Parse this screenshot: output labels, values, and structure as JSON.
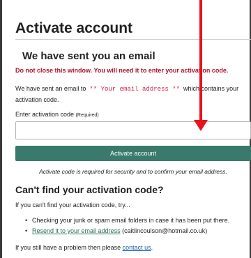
{
  "page": {
    "title": "Activate account",
    "subheading": "We have sent you an email",
    "warning": "Do not close this window. You will need it to enter your activation code.",
    "sent_prefix": "We have sent an email to",
    "email_placeholder": "** Your email address **",
    "sent_suffix": "which contains your activation code.",
    "field_label": "Enter activation code",
    "field_required": "(Required)",
    "field_value": "",
    "button_label": "Activate account",
    "note": "Activate code is required for security and to confirm your email address.",
    "help_heading": "Can't find your activation code?",
    "help_intro": "If you can't find your activation code, try...",
    "tips": {
      "tip1": "Checking your junk or spam email folders in case it has been put there.",
      "resend_link": "Resend it to your email address",
      "resend_email": "(caitlincoulson@hotmail.co.uk)"
    },
    "footer_prefix": "If you still have a problem then please",
    "footer_link": "contact us",
    "footer_suffix": "."
  },
  "colors": {
    "accent_button": "#3a7a6c",
    "warning": "#b0102c",
    "email_placeholder": "#d0204a",
    "annotation_arrow": "#e8121b"
  }
}
